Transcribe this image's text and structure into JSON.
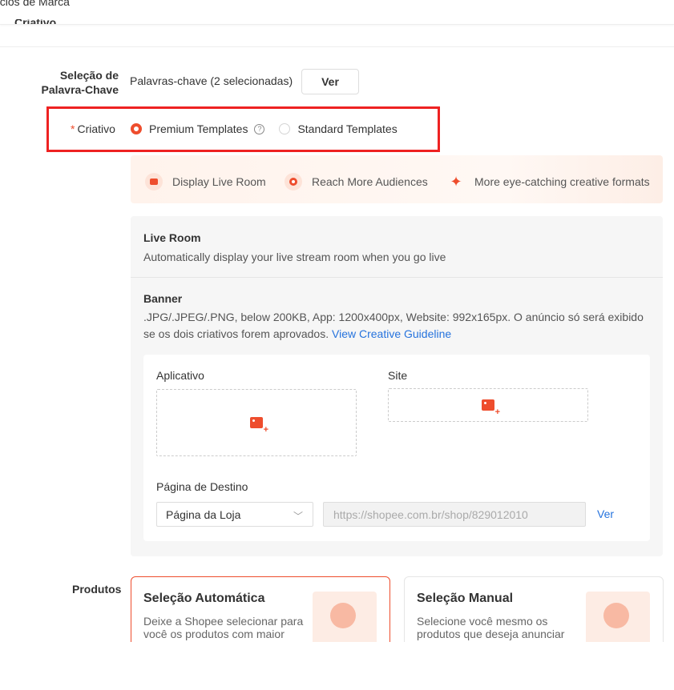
{
  "breadcrumb": "ncios de Marca",
  "section_title": "Criativo",
  "keywords": {
    "label": "Seleção de Palavra-Chave",
    "text": "Palavras-chave (2 selecionadas)",
    "button": "Ver"
  },
  "criativo": {
    "required_mark": "*",
    "label": "Criativo",
    "options": [
      {
        "label": "Premium Templates",
        "selected": true
      },
      {
        "label": "Standard Templates",
        "selected": false
      }
    ],
    "help_icon": "?"
  },
  "promo": {
    "items": [
      {
        "icon": "live-room-icon",
        "label": "Display Live Room"
      },
      {
        "icon": "eye-icon",
        "label": "Reach More Audiences"
      },
      {
        "icon": "sparkle-icon",
        "label": "More eye-catching creative formats"
      }
    ]
  },
  "live_room": {
    "title": "Live Room",
    "desc": "Automatically display your live stream room when you go live"
  },
  "banner": {
    "title": "Banner",
    "desc": ".JPG/.JPEG/.PNG, below 200KB, App: 1200x400px, Website: 992x165px. O anúncio só será exibido se os dois criativos forem aprovados.",
    "link": "View Creative Guideline",
    "app_label": "Aplicativo",
    "site_label": "Site",
    "landing_label": "Página de Destino",
    "landing_select": "Página da Loja",
    "url": "https://shopee.com.br/shop/829012010",
    "ver_link": "Ver"
  },
  "produtos": {
    "label": "Produtos",
    "auto": {
      "title": "Seleção Automática",
      "desc": "Deixe a Shopee selecionar para você os produtos com maior"
    },
    "manual": {
      "title": "Seleção Manual",
      "desc": "Selecione você mesmo os produtos que deseja anunciar"
    }
  },
  "colors": {
    "accent": "#ee4d2d",
    "link": "#2673dd",
    "highlight_box": "#ee2222"
  }
}
